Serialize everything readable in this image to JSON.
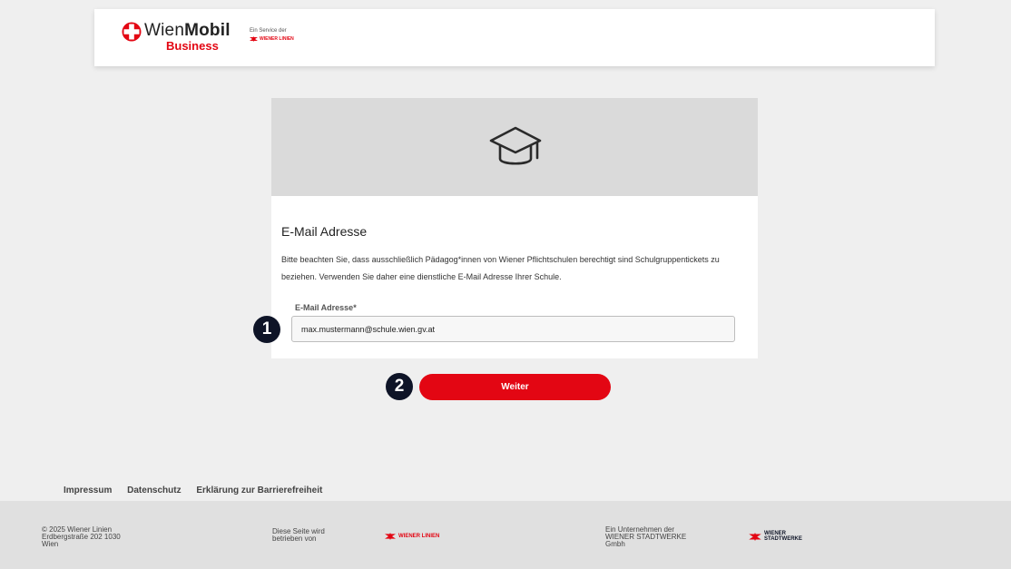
{
  "header": {
    "brand_wien": "Wien",
    "brand_mobil": "Mobil",
    "brand_sub": "Business",
    "service_text": "Ein Service der",
    "service_logo_text": "WIENER LINIEN"
  },
  "card": {
    "title": "E-Mail Adresse",
    "description": "Bitte beachten Sie, dass ausschließlich Pädagog*innen von Wiener Pflichtschulen berechtigt sind Schulgruppentickets zu beziehen. Verwenden Sie daher eine dienstliche E-Mail Adresse Ihrer Schule.",
    "email_label": "E-Mail Adresse*",
    "email_value": "max.mustermann@schule.wien.gv.at"
  },
  "steps": {
    "one": "1",
    "two": "2"
  },
  "button": {
    "label": "Weiter"
  },
  "footer_links": [
    "Impressum",
    "Datenschutz",
    "Erklärung zur Barrierefreiheit"
  ],
  "footer": {
    "copyright": "© 2025 Wiener Linien\nErdbergstraße 202 1030\nWien",
    "operated_by": "Diese Seite wird\nbetrieben von",
    "operated_logo_text": "WIENER LINIEN",
    "company": "Ein Unternehmen der\nWIENER STADTWERKE\nGmbh",
    "company_logo_text": "WIENER\nSTADTWERKE"
  },
  "colors": {
    "accent": "#e30613",
    "badge": "#0e1427",
    "background": "#efefef"
  }
}
